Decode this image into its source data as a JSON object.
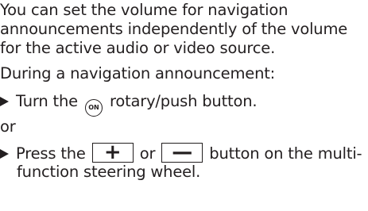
{
  "paragraph": {
    "line1": "You can set the volume for navigation",
    "line2": "announcements independently of the volume",
    "line3": "for the active audio or video source."
  },
  "intro": "During a navigation announcement:",
  "step1": {
    "before": "Turn the",
    "icon_label": "ON",
    "after": "rotary/push button."
  },
  "or_text": "or",
  "step2": {
    "before": "Press the",
    "plus_key": "+",
    "middle": "or",
    "minus_key": "—",
    "after": "button on the multi-",
    "continuation": "function steering wheel."
  },
  "icons": {
    "bullet": "arrow-bullet-icon",
    "on_button": "on-rotary-button-icon"
  }
}
